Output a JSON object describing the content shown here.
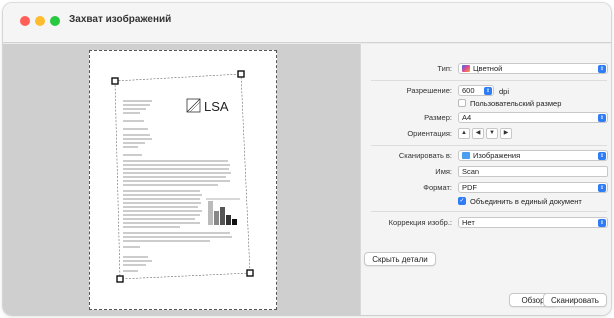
{
  "window": {
    "title": "Захват изображений"
  },
  "preview": {
    "doc_logo": "LSA"
  },
  "settings": {
    "type": {
      "label": "Тип:",
      "value": "Цветной",
      "icon": "color-swatch-icon"
    },
    "resolution": {
      "label": "Разрешение:",
      "value": "600",
      "unit": "dpi"
    },
    "custom_size": {
      "label": "Пользовательский размер",
      "checked": false
    },
    "size": {
      "label": "Размер:",
      "value": "A4"
    },
    "orientation": {
      "label": "Ориентация:"
    },
    "scan_to": {
      "label": "Сканировать в:",
      "value": "Изображения",
      "icon": "folder-icon"
    },
    "name": {
      "label": "Имя:",
      "value": "Scan"
    },
    "format": {
      "label": "Формат:",
      "value": "PDF"
    },
    "combine": {
      "label": "Объединить в единый документ",
      "checked": true
    },
    "correction": {
      "label": "Коррекция изобр.:",
      "value": "Нет"
    }
  },
  "buttons": {
    "hide_details": "Скрыть детали",
    "browse": "Обзор",
    "scan": "Сканировать"
  },
  "colors": {
    "accent": "#2f7cf6",
    "close": "#ff5f57",
    "minimize": "#febc2e",
    "zoom": "#28c840"
  }
}
